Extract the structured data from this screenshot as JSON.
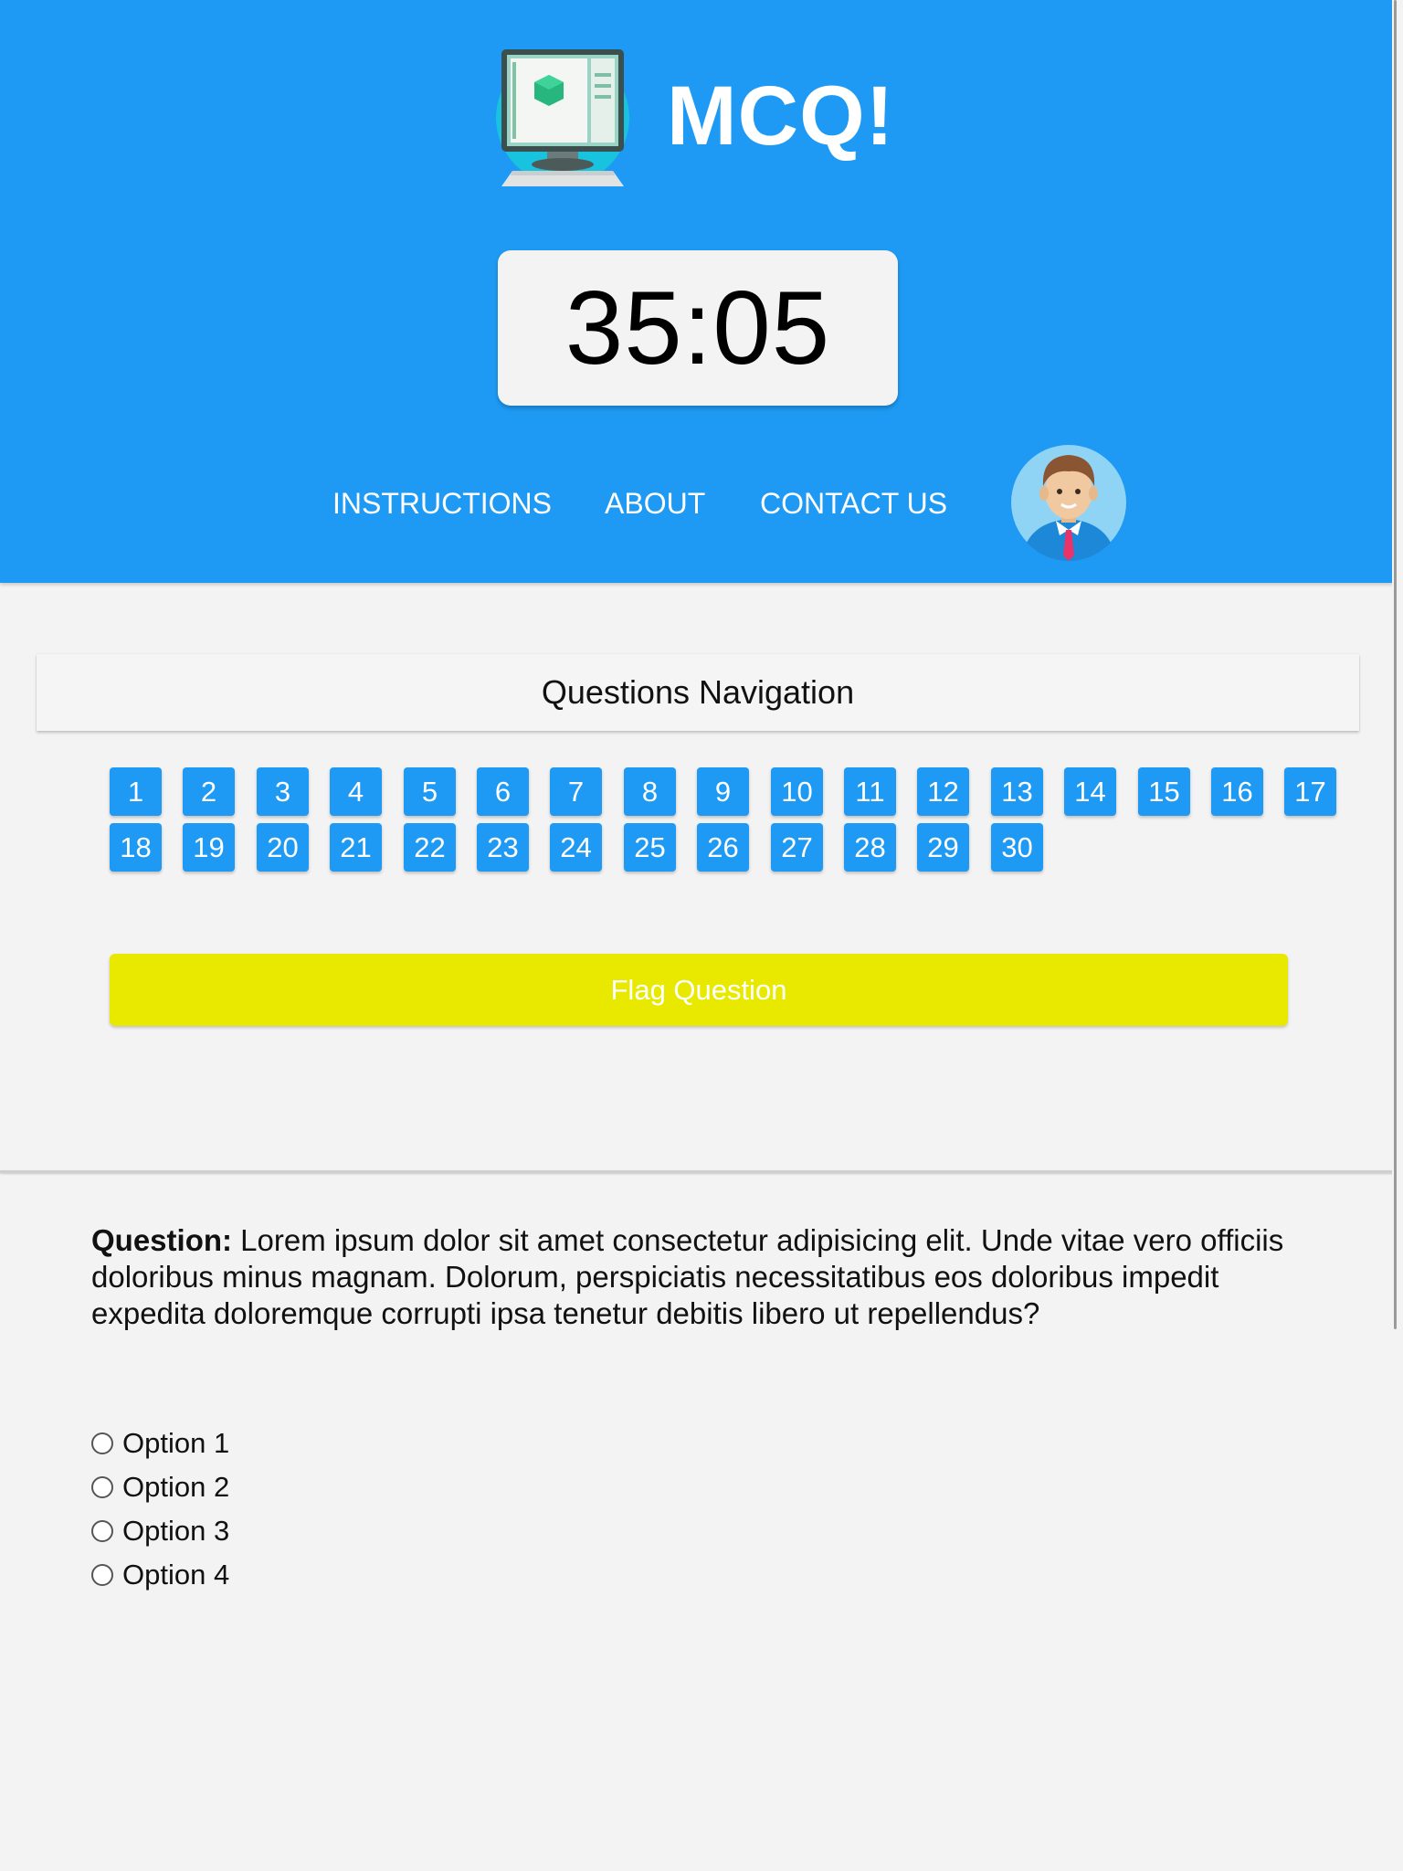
{
  "header": {
    "brand": "MCQ!",
    "timer": "35:05",
    "nav": [
      {
        "label": "INSTRUCTIONS"
      },
      {
        "label": "ABOUT"
      },
      {
        "label": "CONTACT US"
      }
    ],
    "logo_icon": "computer-monitor-icon",
    "avatar_icon": "user-avatar-icon"
  },
  "navigation": {
    "title": "Questions Navigation",
    "questions": [
      "1",
      "2",
      "3",
      "4",
      "5",
      "6",
      "7",
      "8",
      "9",
      "10",
      "11",
      "12",
      "13",
      "14",
      "15",
      "16",
      "17",
      "18",
      "19",
      "20",
      "21",
      "22",
      "23",
      "24",
      "25",
      "26",
      "27",
      "28",
      "29",
      "30"
    ],
    "flag_label": "Flag Question"
  },
  "question": {
    "prefix": "Question:",
    "text": " Lorem ipsum dolor sit amet consectetur adipisicing elit. Unde vitae vero officiis doloribus minus magnam. Dolorum, perspiciatis necessitatibus eos doloribus impedit expedita doloremque corrupti ipsa tenetur debitis libero ut repellendus?",
    "options": [
      "Option 1",
      "Option 2",
      "Option 3",
      "Option 4"
    ]
  },
  "colors": {
    "primary": "#1e9af4",
    "flag": "#e9e900",
    "background": "#f3f3f3"
  }
}
